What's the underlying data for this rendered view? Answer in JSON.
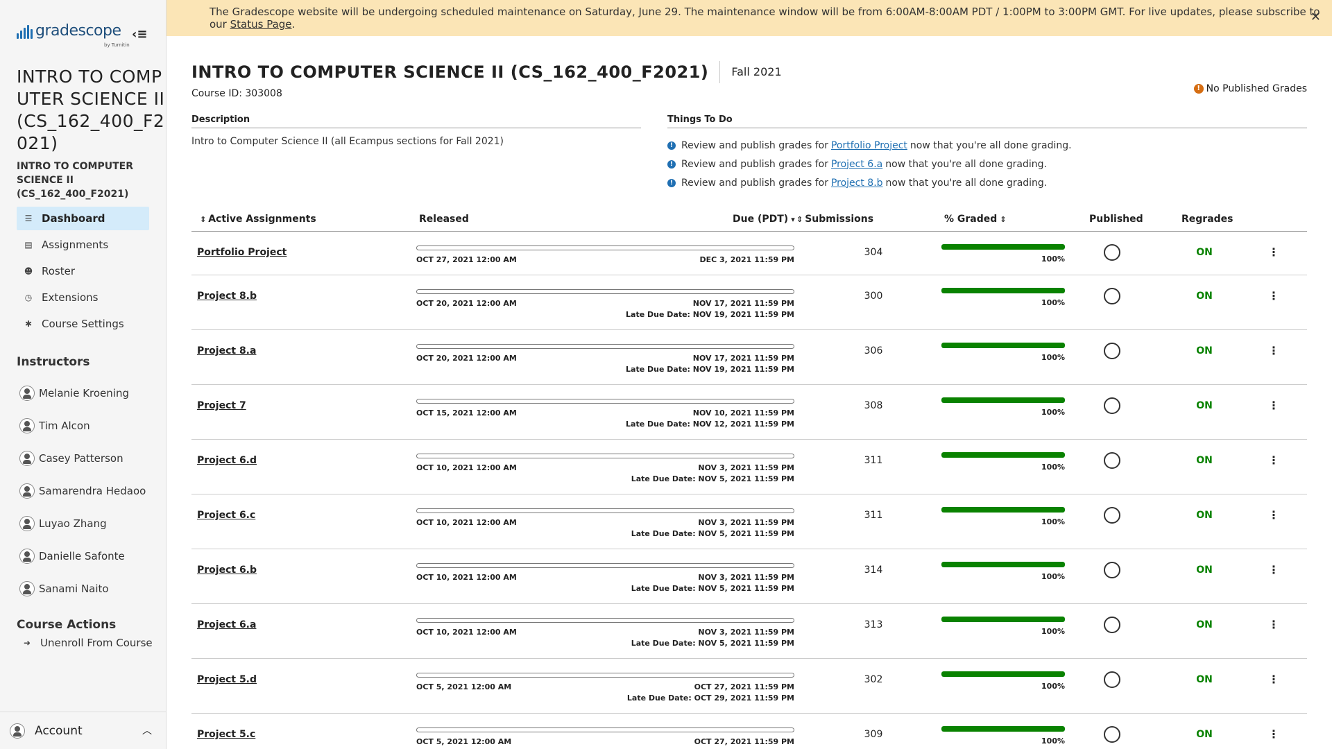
{
  "banner": {
    "text_before": "The Gradescope website will be undergoing scheduled maintenance on Saturday, June 29. The maintenance window will be from 6:00AM-8:00AM PDT / 1:00PM to 3:00PM GMT. For live updates, please subscribe to our ",
    "link": "Status Page",
    "text_after": ".",
    "bg_color": "#fbe5b6"
  },
  "brand": {
    "name": "gradescope",
    "sub": "by Turnitin",
    "color": "#1f6fb2"
  },
  "sidebar": {
    "course_title": "INTRO TO COMPUTER SCIENCE II (CS_162_400_F2021)",
    "course_subtitle": "INTRO TO COMPUTER SCIENCE II (CS_162_400_F2021)",
    "nav": [
      {
        "label": "Dashboard",
        "icon": "dashboard-icon",
        "active": true
      },
      {
        "label": "Assignments",
        "icon": "assignments-icon"
      },
      {
        "label": "Roster",
        "icon": "roster-icon"
      },
      {
        "label": "Extensions",
        "icon": "clock-icon"
      },
      {
        "label": "Course Settings",
        "icon": "gear-icon"
      }
    ],
    "instructors_title": "Instructors",
    "instructors": [
      "Melanie Kroening",
      "Tim Alcon",
      "Casey Patterson",
      "Samarendra Hedaoo",
      "Luyao Zhang",
      "Danielle Safonte",
      "Sanami Naito"
    ],
    "course_actions_title": "Course Actions",
    "unenroll_label": "Unenroll From Course",
    "account_label": "Account",
    "active_color": "#d4ebfa"
  },
  "course": {
    "title": "INTRO TO COMPUTER SCIENCE II (CS_162_400_F2021)",
    "term": "Fall 2021",
    "id_label": "Course ID: 303008",
    "no_published": "No Published Grades",
    "description_heading": "Description",
    "description": "Intro to Computer Science II (all Ecampus sections for Fall 2021)",
    "todo_heading": "Things To Do",
    "todos": [
      {
        "before": "Review and publish grades for",
        "link": "Portfolio Project",
        "after": "now that you're all done grading."
      },
      {
        "before": "Review and publish grades for",
        "link": "Project 6.a",
        "after": "now that you're all done grading."
      },
      {
        "before": "Review and publish grades for",
        "link": "Project 8.b",
        "after": "now that you're all done grading."
      }
    ]
  },
  "table": {
    "headers": {
      "assignments": "Active Assignments",
      "released": "Released",
      "due": "Due (PDT)",
      "submissions": "Submissions",
      "graded": "% Graded",
      "published": "Published",
      "regrades": "Regrades"
    },
    "late_prefix": "Late Due Date: ",
    "rows": [
      {
        "name": "Portfolio Project",
        "released": "OCT 27, 2021 12:00 AM",
        "due": "DEC 3, 2021 11:59 PM",
        "late": "",
        "submissions": "304",
        "graded_pct": 100,
        "graded": "100%",
        "regrades": "ON"
      },
      {
        "name": "Project 8.b",
        "released": "OCT 20, 2021 12:00 AM",
        "due": "NOV 17, 2021 11:59 PM",
        "late": "NOV 19, 2021 11:59 PM",
        "submissions": "300",
        "graded_pct": 100,
        "graded": "100%",
        "regrades": "ON"
      },
      {
        "name": "Project 8.a",
        "released": "OCT 20, 2021 12:00 AM",
        "due": "NOV 17, 2021 11:59 PM",
        "late": "NOV 19, 2021 11:59 PM",
        "submissions": "306",
        "graded_pct": 100,
        "graded": "100%",
        "regrades": "ON"
      },
      {
        "name": "Project 7",
        "released": "OCT 15, 2021 12:00 AM",
        "due": "NOV 10, 2021 11:59 PM",
        "late": "NOV 12, 2021 11:59 PM",
        "submissions": "308",
        "graded_pct": 100,
        "graded": "100%",
        "regrades": "ON"
      },
      {
        "name": "Project 6.d",
        "released": "OCT 10, 2021 12:00 AM",
        "due": "NOV 3, 2021 11:59 PM",
        "late": "NOV 5, 2021 11:59 PM",
        "submissions": "311",
        "graded_pct": 100,
        "graded": "100%",
        "regrades": "ON"
      },
      {
        "name": "Project 6.c",
        "released": "OCT 10, 2021 12:00 AM",
        "due": "NOV 3, 2021 11:59 PM",
        "late": "NOV 5, 2021 11:59 PM",
        "submissions": "311",
        "graded_pct": 100,
        "graded": "100%",
        "regrades": "ON"
      },
      {
        "name": "Project 6.b",
        "released": "OCT 10, 2021 12:00 AM",
        "due": "NOV 3, 2021 11:59 PM",
        "late": "NOV 5, 2021 11:59 PM",
        "submissions": "314",
        "graded_pct": 100,
        "graded": "100%",
        "regrades": "ON"
      },
      {
        "name": "Project 6.a",
        "released": "OCT 10, 2021 12:00 AM",
        "due": "NOV 3, 2021 11:59 PM",
        "late": "NOV 5, 2021 11:59 PM",
        "submissions": "313",
        "graded_pct": 100,
        "graded": "100%",
        "regrades": "ON"
      },
      {
        "name": "Project 5.d",
        "released": "OCT 5, 2021 12:00 AM",
        "due": "OCT 27, 2021 11:59 PM",
        "late": "OCT 29, 2021 11:59 PM",
        "submissions": "302",
        "graded_pct": 100,
        "graded": "100%",
        "regrades": "ON"
      },
      {
        "name": "Project 5.c",
        "released": "OCT 5, 2021 12:00 AM",
        "due": "OCT 27, 2021 11:59 PM",
        "late": "",
        "submissions": "309",
        "graded_pct": 100,
        "graded": "100%",
        "regrades": "ON"
      }
    ],
    "graded_color": "#098200",
    "regrade_color": "#098200"
  }
}
